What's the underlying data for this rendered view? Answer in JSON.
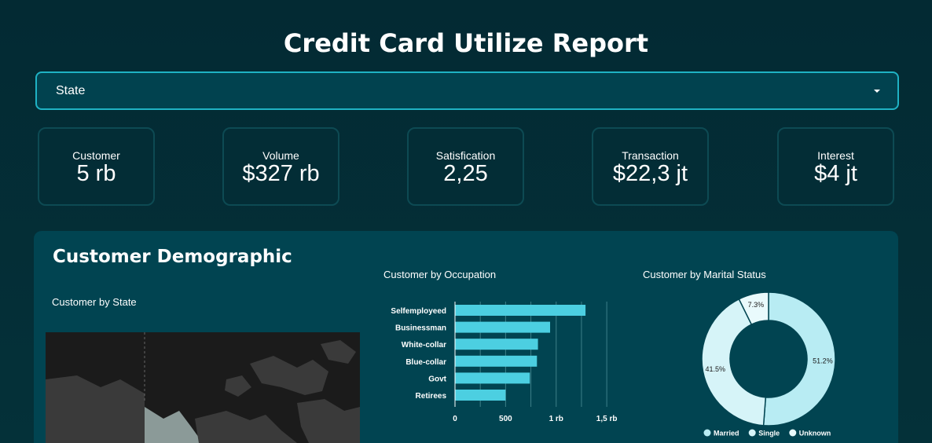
{
  "header": {
    "title": "Credit Card Utilize Report"
  },
  "filter": {
    "label": "State"
  },
  "kpis": [
    {
      "label": "Customer",
      "value": "5 rb"
    },
    {
      "label": "Volume",
      "value": "$327 rb"
    },
    {
      "label": "Satisfication",
      "value": "2,25"
    },
    {
      "label": "Transaction",
      "value": "$22,3 jt"
    },
    {
      "label": "Interest",
      "value": "$4 jt"
    }
  ],
  "demographic": {
    "title": "Customer Demographic",
    "state_title": "Customer by State",
    "occupation_title": "Customer by Occupation",
    "marital_title": "Customer by Marital Status"
  },
  "chart_data": [
    {
      "type": "bar",
      "orientation": "horizontal",
      "title": "Customer by Occupation",
      "categories": [
        "Selfemployeed",
        "Businessman",
        "White-collar",
        "Blue-collar",
        "Govt",
        "Retirees"
      ],
      "values": [
        1290,
        940,
        820,
        810,
        740,
        500
      ],
      "xlim": [
        0,
        1600
      ],
      "tick_labels": [
        "0",
        "500",
        "1 rb",
        "1,5 rb"
      ],
      "color": "#4ccfe1",
      "grid": true
    },
    {
      "type": "pie",
      "donut": true,
      "title": "Customer by Marital Status",
      "categories": [
        "Married",
        "Single",
        "Unknown"
      ],
      "values": [
        51.2,
        41.5,
        7.3
      ],
      "value_labels": [
        "51.2%",
        "41.5%",
        "7.3%"
      ],
      "colors": [
        "#b8ecf3",
        "#d6f4f8",
        "#e9fafc"
      ],
      "legend_position": "bottom"
    }
  ]
}
